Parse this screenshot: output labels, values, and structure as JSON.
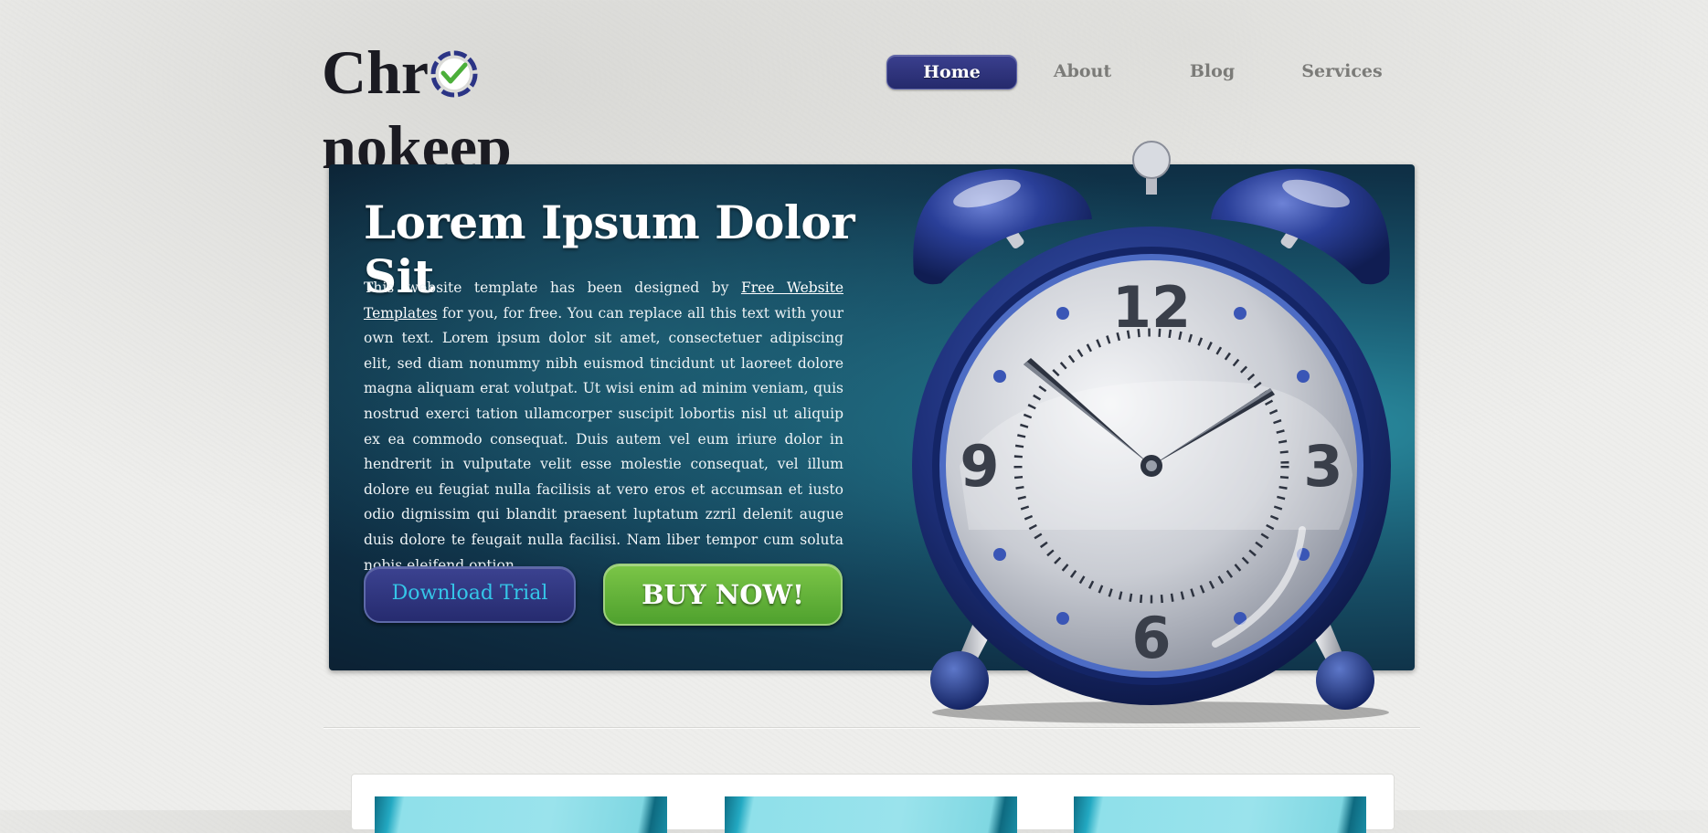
{
  "header": {
    "logo": {
      "part1": "Chr",
      "part2": "nokeep"
    },
    "nav": [
      {
        "label": "Home",
        "active": true
      },
      {
        "label": "About",
        "active": false
      },
      {
        "label": "Blog",
        "active": false
      },
      {
        "label": "Services",
        "active": false
      }
    ]
  },
  "hero": {
    "title": "Lorem Ipsum Dolor Sit",
    "text_before_link": "This website template has been designed by ",
    "link_text": "Free Website Templates",
    "text_after_link": " for you, for free. You can replace all this text with your own text. Lorem ipsum dolor sit amet, consectetuer adipiscing elit, sed diam nonummy nibh euismod tincidunt ut laoreet dolore magna aliquam erat volutpat. Ut wisi enim ad minim veniam, quis nostrud exerci tation ullamcorper suscipit lobortis nisl ut aliquip ex ea commodo consequat. Duis autem vel eum iriure dolor in hendrerit in vulputate velit esse molestie consequat, vel illum dolore eu feugiat nulla facilisis at vero eros et accumsan et iusto odio dignissim qui blandit praesent luptatum zzril delenit augue duis dolore te feugait nulla facilisi. Nam liber tempor cum soluta nobis eleifend option",
    "download_button": "Download Trial",
    "buy_button": "BUY NOW!",
    "clock_numbers": {
      "twelve": "12",
      "three": "3",
      "six": "6",
      "nine": "9"
    }
  },
  "colors": {
    "brand_navy": "#262b6f",
    "accent_cyan": "#35c6e8",
    "buy_green": "#5fb13a",
    "hero_teal": "#174f66"
  }
}
